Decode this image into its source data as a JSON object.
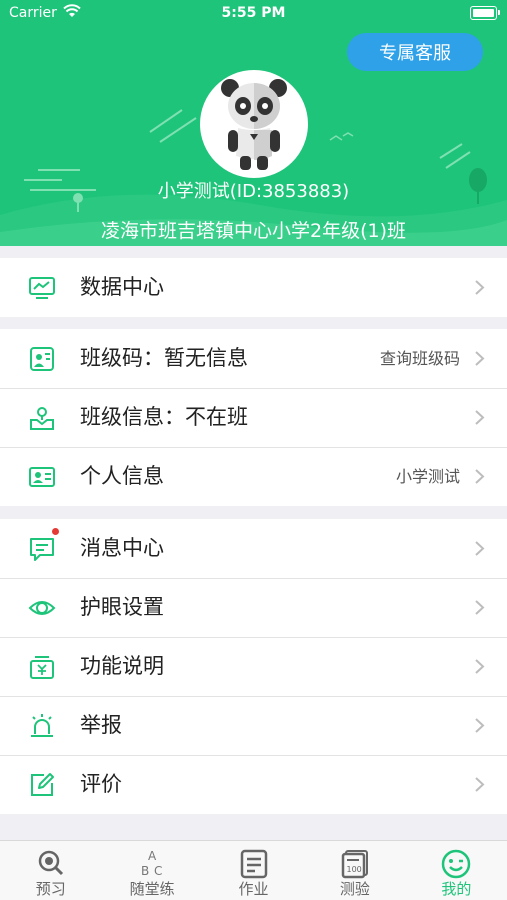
{
  "status_bar": {
    "carrier": "Carrier",
    "time": "5:55 PM"
  },
  "header": {
    "service_button": "专属客服",
    "user_line": "小学测试(ID:3853883)",
    "school_line": "凌海市班吉塔镇中心小学2年级(1)班"
  },
  "groups": [
    {
      "items": [
        {
          "label": "数据中心",
          "icon": "monitor-chart-icon"
        }
      ]
    },
    {
      "items": [
        {
          "label": "班级码：暂无信息",
          "detail": "查询班级码",
          "icon": "class-code-icon"
        },
        {
          "label": "班级信息：不在班",
          "detail": "",
          "icon": "class-location-icon"
        },
        {
          "label": "个人信息",
          "detail": "小学测试",
          "icon": "id-card-icon"
        }
      ]
    },
    {
      "items": [
        {
          "label": "消息中心",
          "icon": "message-icon",
          "badge": true
        },
        {
          "label": "护眼设置",
          "icon": "eye-icon"
        },
        {
          "label": "功能说明",
          "icon": "manual-icon"
        },
        {
          "label": "举报",
          "icon": "alarm-icon"
        },
        {
          "label": "评价",
          "icon": "edit-icon"
        }
      ]
    }
  ],
  "tabbar": {
    "tabs": [
      {
        "label": "预习",
        "icon": "magnifier-icon"
      },
      {
        "label": "随堂练",
        "icon": "abc-icon"
      },
      {
        "label": "作业",
        "icon": "homework-icon"
      },
      {
        "label": "测验",
        "icon": "test-icon"
      },
      {
        "label": "我的",
        "icon": "smiley-icon",
        "active": true
      }
    ]
  },
  "colors": {
    "brand_green": "#1ec47a",
    "service_blue": "#2ea1e8",
    "badge_red": "#e53935"
  }
}
